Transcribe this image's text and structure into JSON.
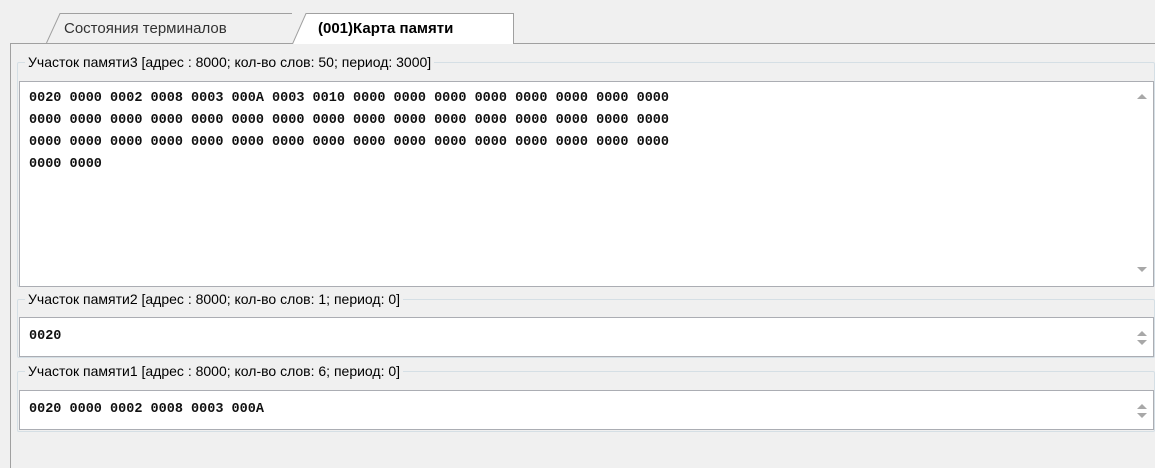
{
  "tabs": [
    {
      "label": "Состояния терминалов",
      "active": false
    },
    {
      "label": "(001)Карта памяти",
      "active": true
    }
  ],
  "groups": [
    {
      "title": "Участок памяти3 [адрес : 8000;  кол-во слов: 50; период: 3000]",
      "content": "0020 0000 0002 0008 0003 000A 0003 0010 0000 0000 0000 0000 0000 0000 0000 0000\n0000 0000 0000 0000 0000 0000 0000 0000 0000 0000 0000 0000 0000 0000 0000 0000\n0000 0000 0000 0000 0000 0000 0000 0000 0000 0000 0000 0000 0000 0000 0000 0000\n0000 0000"
    },
    {
      "title": "Участок памяти2 [адрес : 8000;  кол-во слов: 1; период: 0]",
      "content": "0020"
    },
    {
      "title": "Участок памяти1 [адрес : 8000;  кол-во слов: 6; период: 0]",
      "content": "0020 0000 0002 0008 0003 000A"
    }
  ],
  "icons": {
    "scroll_up": "scroll-up-icon",
    "scroll_down": "scroll-down-icon"
  },
  "colors": {
    "background": "#f0f0f0",
    "textbox_background": "#ffffff",
    "textbox_border": "#abadb3",
    "group_border": "#d5dfe5"
  }
}
